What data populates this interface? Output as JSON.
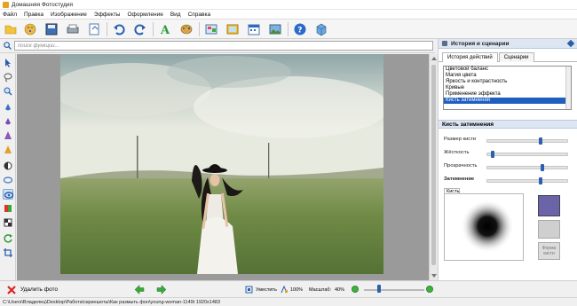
{
  "window": {
    "title": "Домашняя Фотостудия"
  },
  "menu": [
    "Файл",
    "Правка",
    "Изображение",
    "Эффекты",
    "Оформление",
    "Вид",
    "Справка"
  ],
  "search": {
    "placeholder": "поиск функций..."
  },
  "history_panel": {
    "title": "История и сценарии",
    "tabs": [
      "История действий",
      "Сценарии"
    ],
    "items": [
      "Цветовой баланс",
      "Магия цвета",
      "Яркость и контрастность",
      "Кривые",
      "Применение эффекта",
      "Кисть затемнения"
    ],
    "selected_index": 5
  },
  "brush_panel": {
    "title": "Кисть затемнения",
    "params": [
      {
        "label": "Размер кисти",
        "value": 0.68
      },
      {
        "label": "Жёсткость",
        "value": 0.05
      },
      {
        "label": "Прозрачность",
        "value": 0.7
      },
      {
        "label": "Затемнение",
        "value": 0.68
      }
    ],
    "brush_tab": "Кисть",
    "color": "#6b64a8",
    "form_button": "Форма кисти"
  },
  "bottom": {
    "delete_label": "Удалить фото",
    "fit_label": "Уместить",
    "zoom100_label": "100%",
    "scale_label": "Масштаб:",
    "scale_value": "40%",
    "zoom_slider": 0.22
  },
  "status": {
    "path": "C:\\Users\\Владелец\\Desktop\\Работа\\скриншоты\\Как размыть фон\\young-woman-1149t   1920x1483"
  },
  "colors": {
    "accent": "#1f5fbf",
    "slider": "#2d5fb0",
    "zoom_buttons": "#40b040"
  }
}
